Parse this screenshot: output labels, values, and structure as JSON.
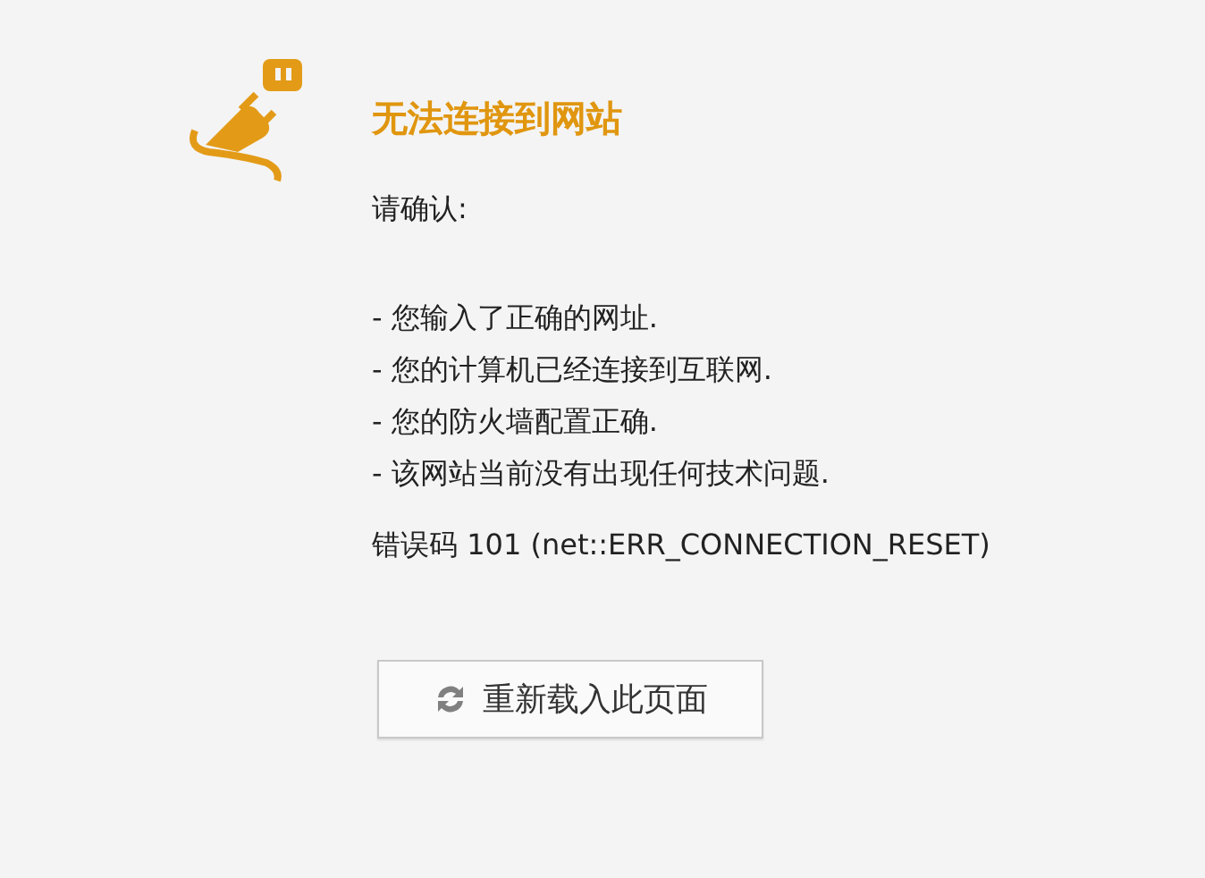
{
  "title": "无法连接到网站",
  "intro": "请确认:",
  "checks": [
    "- 您输入了正确的网址.",
    "- 您的计算机已经连接到互联网.",
    "- 您的防火墙配置正确.",
    "- 该网站当前没有出现任何技术问题."
  ],
  "error_code": "错误码 101 (net::ERR_CONNECTION_RESET)",
  "reload_button": {
    "label": "重新载入此页面"
  }
}
